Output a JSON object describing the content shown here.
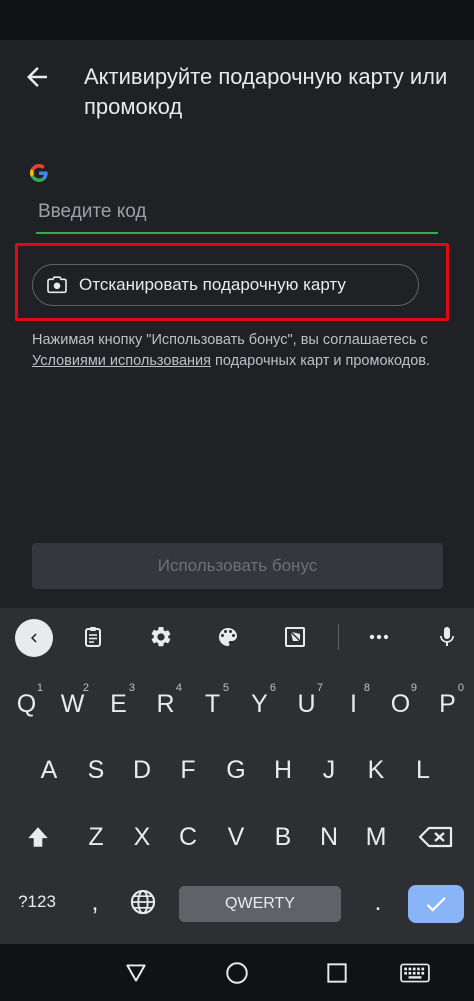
{
  "header": {
    "title": "Активируйте подарочную карту или промокод"
  },
  "code_input": {
    "placeholder": "Введите код",
    "value": ""
  },
  "scan_button": {
    "label": "Отсканировать подарочную карту"
  },
  "terms": {
    "text_before": "Нажимая кнопку \"Использовать бонус\", вы соглашаетесь с ",
    "link_text": "Условиями использования",
    "text_after": " подарочных карт и промокодов."
  },
  "redeem_button": {
    "label": "Использовать бонус"
  },
  "keyboard": {
    "toolbar_icons": [
      "collapse-icon",
      "clipboard-icon",
      "gear-icon",
      "palette-icon",
      "resize-icon",
      "more-icon",
      "microphone-icon"
    ],
    "row1": [
      {
        "char": "Q",
        "hint": "1"
      },
      {
        "char": "W",
        "hint": "2"
      },
      {
        "char": "E",
        "hint": "3"
      },
      {
        "char": "R",
        "hint": "4"
      },
      {
        "char": "T",
        "hint": "5"
      },
      {
        "char": "Y",
        "hint": "6"
      },
      {
        "char": "U",
        "hint": "7"
      },
      {
        "char": "I",
        "hint": "8"
      },
      {
        "char": "O",
        "hint": "9"
      },
      {
        "char": "P",
        "hint": "0"
      }
    ],
    "row2": [
      "A",
      "S",
      "D",
      "F",
      "G",
      "H",
      "J",
      "K",
      "L"
    ],
    "row3": [
      "Z",
      "X",
      "C",
      "V",
      "B",
      "N",
      "M"
    ],
    "symbols_label": "?123",
    "comma_label": ",",
    "space_label": "QWERTY",
    "period_label": "."
  },
  "colors": {
    "accent_green": "#34a853",
    "highlight_red": "#e30613",
    "enter_blue": "#8ab4f8"
  }
}
